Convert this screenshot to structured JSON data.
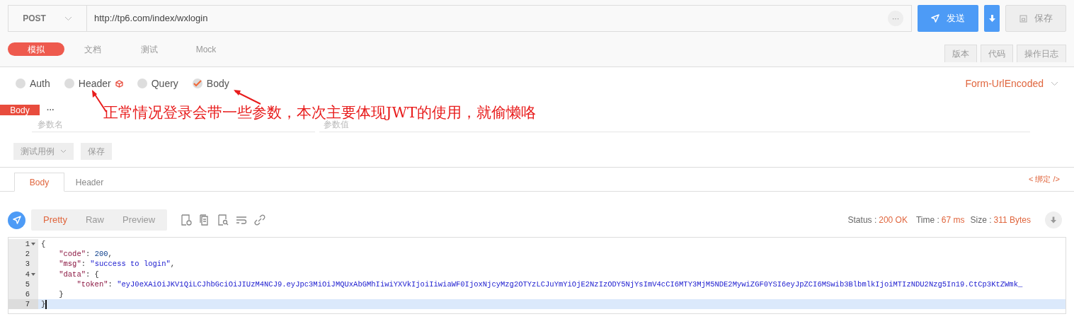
{
  "request": {
    "method": "POST",
    "url": "http://tp6.com/index/wxlogin",
    "more": "···",
    "send": "发送",
    "save": "保存"
  },
  "tabs": [
    {
      "label": "模拟",
      "selected": true
    },
    {
      "label": "文档",
      "selected": false
    },
    {
      "label": "测试",
      "selected": false
    },
    {
      "label": "Mock",
      "selected": false
    }
  ],
  "side_buttons": [
    "版本",
    "代码",
    "操作日志"
  ],
  "param_types": [
    {
      "label": "Auth",
      "checked": false,
      "badge": false
    },
    {
      "label": "Header",
      "checked": false,
      "badge": true
    },
    {
      "label": "Query",
      "checked": false,
      "badge": false
    },
    {
      "label": "Body",
      "checked": true,
      "badge": false
    }
  ],
  "body_format": "Form-UrlEncoded",
  "body_tag": "Body",
  "body_more": "···",
  "params": {
    "name_placeholder": "参数名",
    "value_placeholder": "参数值"
  },
  "test_case": "测试用例",
  "test_save": "保存",
  "annotation": "正常情况登录会带一些参数，本次主要体现JWT的使用，就偷懒咯",
  "response_tabs": [
    {
      "label": "Body",
      "selected": true
    },
    {
      "label": "Header",
      "selected": false
    }
  ],
  "bind": "< 绑定 />",
  "view_modes": [
    {
      "label": "Pretty",
      "selected": true
    },
    {
      "label": "Raw",
      "selected": false
    },
    {
      "label": "Preview",
      "selected": false
    }
  ],
  "status": {
    "status_label": "Status :",
    "status": "200 OK",
    "time_label": "Time :",
    "time": "67 ms",
    "size_label": "Size :",
    "size": "311 Bytes"
  },
  "code_lines": [
    {
      "number": "1",
      "fold": true,
      "active": false,
      "segments": [
        {
          "text": "{",
          "kind": "punct"
        }
      ]
    },
    {
      "number": "2",
      "fold": false,
      "active": false,
      "segments": [
        {
          "text": "    \"code\"",
          "kind": "key"
        },
        {
          "text": ": ",
          "kind": "punct"
        },
        {
          "text": "200",
          "kind": "number"
        },
        {
          "text": ",",
          "kind": "punct"
        }
      ]
    },
    {
      "number": "3",
      "fold": false,
      "active": false,
      "segments": [
        {
          "text": "    \"msg\"",
          "kind": "key"
        },
        {
          "text": ": ",
          "kind": "punct"
        },
        {
          "text": "\"success to login\"",
          "kind": "string"
        },
        {
          "text": ",",
          "kind": "punct"
        }
      ]
    },
    {
      "number": "4",
      "fold": true,
      "active": false,
      "segments": [
        {
          "text": "    \"data\"",
          "kind": "key"
        },
        {
          "text": ": {",
          "kind": "punct"
        }
      ]
    },
    {
      "number": "5",
      "fold": false,
      "active": false,
      "segments": [
        {
          "text": "        \"token\"",
          "kind": "key"
        },
        {
          "text": ": ",
          "kind": "punct"
        },
        {
          "text": "\"eyJ0eXAiOiJKV1QiLCJhbGciOiJIUzM4NCJ9.eyJpc3MiOiJMQUxAbGMhIiwiYXVkIjoiIiwiaWF0IjoxNjcyMzg2OTYzLCJuYmYiOjE2NzIzODY5NjYsImV4cCI6MTY3MjM5NDE2MywiZGF0YSI6eyJpZCI6MSwib3BlbmlkIjoiMTIzNDU2Nzg5In19.CtCp3KtZWmk_",
          "kind": "string"
        }
      ]
    },
    {
      "number": "6",
      "fold": false,
      "active": false,
      "segments": [
        {
          "text": "    }",
          "kind": "punct"
        }
      ]
    },
    {
      "number": "7",
      "fold": false,
      "active": true,
      "segments": [
        {
          "text": "}",
          "kind": "punct"
        }
      ]
    }
  ]
}
